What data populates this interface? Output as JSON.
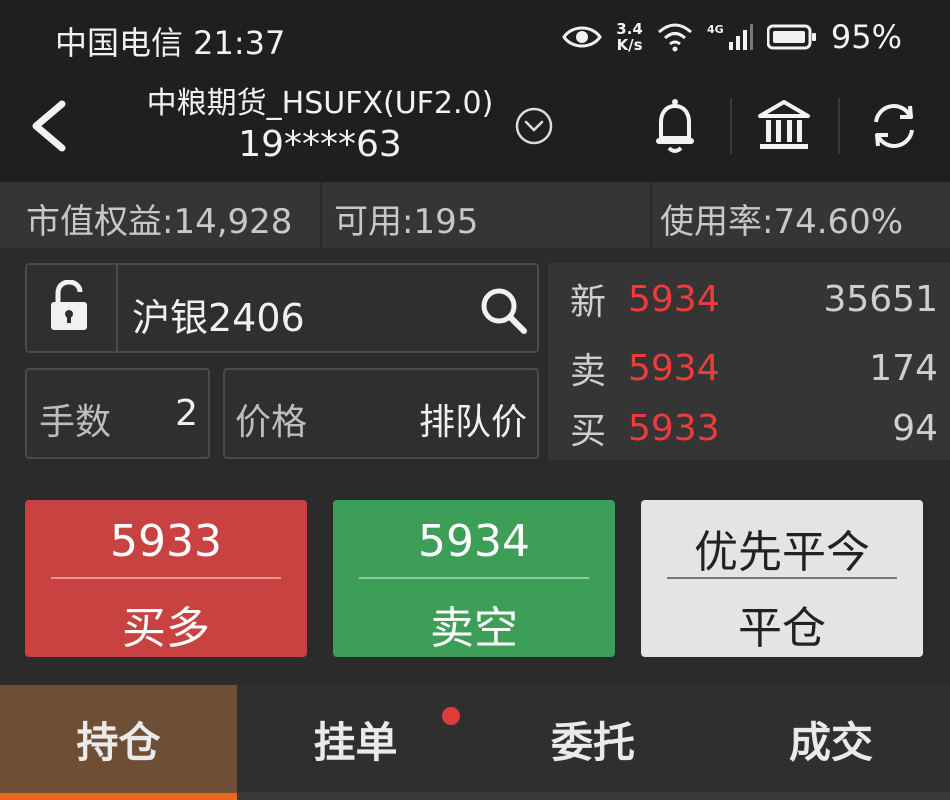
{
  "status_bar": {
    "carrier_time": "中国电信 21:37",
    "speed_value": "3.4",
    "speed_unit": "K/s",
    "network": "4G",
    "battery": "95%",
    "icons": [
      "eye-icon",
      "wifi-icon",
      "signal-icon",
      "battery-icon"
    ]
  },
  "header": {
    "account_name": "中粮期货_HSUFX(UF2.0)",
    "account_id": "19****63",
    "icons": [
      "back-arrow-icon",
      "chevron-down-circle-icon",
      "bell-icon",
      "bank-icon",
      "refresh-icon"
    ]
  },
  "summary": {
    "equity": "市值权益:14,928",
    "available": "可用:195",
    "usage": "使用率:74.60%"
  },
  "order": {
    "contract": "沪银2406",
    "qty_label": "手数",
    "qty_value": "2",
    "price_label": "价格",
    "price_value": "排队价"
  },
  "quote": {
    "rows": [
      {
        "label": "新",
        "price": "5934",
        "volume": "35651"
      },
      {
        "label": "卖",
        "price": "5934",
        "volume": "174"
      },
      {
        "label": "买",
        "price": "5933",
        "volume": "94"
      }
    ],
    "price_color": "#ef3b3b"
  },
  "buttons": {
    "buy": {
      "price": "5933",
      "label": "买多",
      "color": "#c94242"
    },
    "sell": {
      "price": "5934",
      "label": "卖空",
      "color": "#3c9e57"
    },
    "close": {
      "top": "优先平今",
      "label": "平仓",
      "color": "#e4e4e4"
    }
  },
  "tabs": [
    {
      "label": "持仓",
      "active": true
    },
    {
      "label": "挂单",
      "active": false,
      "badge": true
    },
    {
      "label": "委托",
      "active": false
    },
    {
      "label": "成交",
      "active": false
    }
  ],
  "accent": "#e9661e"
}
